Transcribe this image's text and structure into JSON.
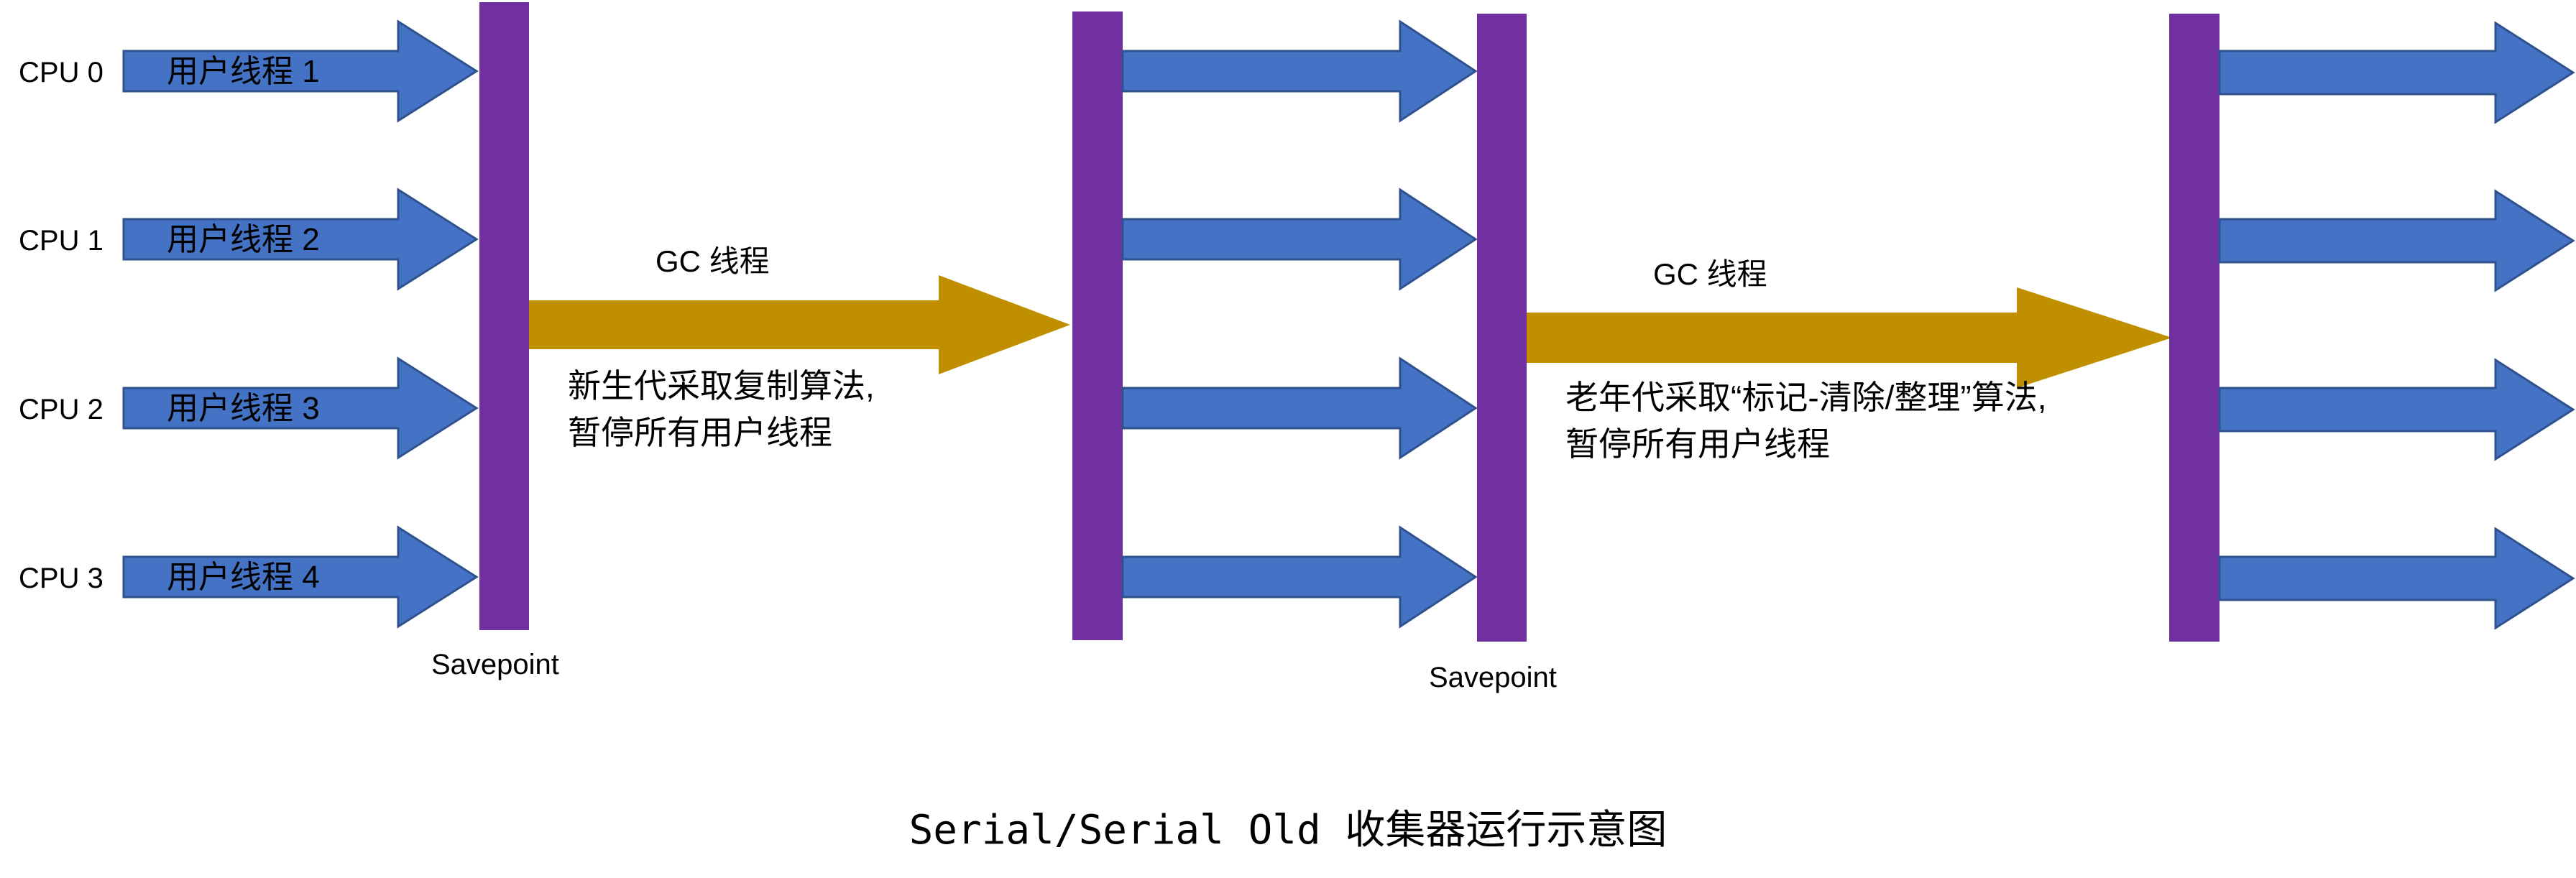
{
  "cpus": [
    {
      "label": "CPU 0",
      "thread_label": "用户线程 1"
    },
    {
      "label": "CPU 1",
      "thread_label": "用户线程 2"
    },
    {
      "label": "CPU 2",
      "thread_label": "用户线程 3"
    },
    {
      "label": "CPU 3",
      "thread_label": "用户线程 4"
    }
  ],
  "gc_phases": [
    {
      "label": "GC 线程",
      "note_line1": "新生代采取复制算法,",
      "note_line2": "暂停所有用户线程",
      "savepoint_label": "Savepoint"
    },
    {
      "label": "GC 线程",
      "note_line1": "老年代采取“标记-清除/整理”算法,",
      "note_line2": "暂停所有用户线程",
      "savepoint_label": "Savepoint"
    }
  ],
  "caption": "Serial/Serial Old 收集器运行示意图",
  "colors": {
    "user_thread_arrow": "#4472C4",
    "user_thread_border": "#2F528F",
    "gc_arrow": "#BF8F00",
    "safepoint_bar": "#7030A0"
  }
}
